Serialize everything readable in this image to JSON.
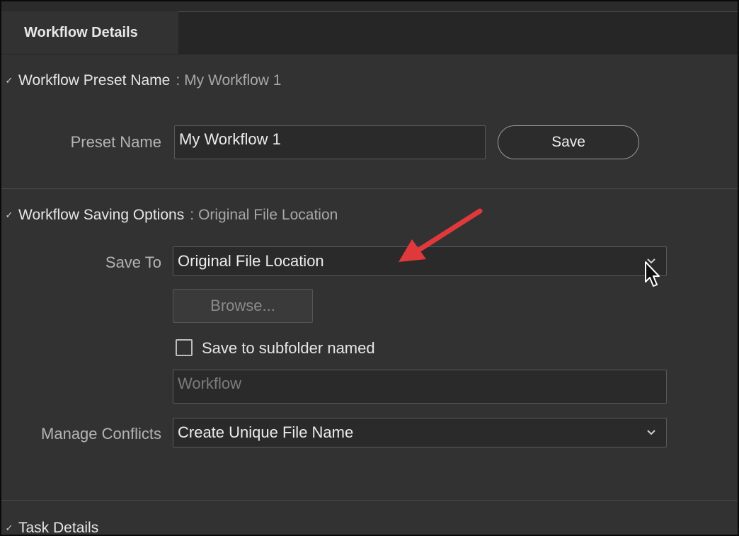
{
  "tabs": {
    "active_label": "Workflow Details"
  },
  "preset_section": {
    "title": "Workflow Preset Name",
    "colon": ":",
    "value": "My Workflow 1",
    "preset_name_label": "Preset Name",
    "preset_name_value": "My Workflow 1",
    "save_label": "Save"
  },
  "saving_section": {
    "title": "Workflow Saving Options",
    "colon": ":",
    "value": "Original File Location",
    "save_to_label": "Save To",
    "save_to_value": "Original File Location",
    "browse_label": "Browse...",
    "subfolder_checkbox_label": "Save to subfolder named",
    "subfolder_checked": false,
    "subfolder_placeholder": "Workflow",
    "manage_conflicts_label": "Manage Conflicts",
    "manage_conflicts_value": "Create Unique File Name"
  },
  "task_section": {
    "title": "Task Details"
  },
  "icons": {
    "section_toggle": "chevron-down-icon",
    "select_toggle": "chevron-down-icon",
    "annotation": "red-arrow-annotation",
    "cursor": "mouse-pointer-icon"
  },
  "colors": {
    "panel_bg": "#323232",
    "tabbar_bg": "#262626",
    "field_bg": "#2a2a2a",
    "annotation_red": "#e0393b"
  }
}
